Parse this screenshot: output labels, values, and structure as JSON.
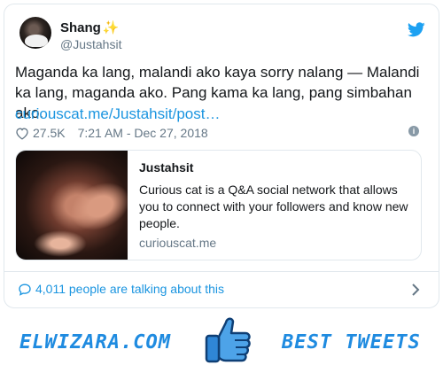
{
  "tweet": {
    "user_name": "Shang",
    "name_emoji": "✨",
    "user_handle": "@Justahsit",
    "text": "Maganda ka lang, malandi ako kaya sorry nalang — Malandi ka lang, maganda ako. Pang kama ka lang, pang simbahan ako.",
    "link": "curiouscat.me/Justahsit/post…",
    "likes": "27.5K",
    "timestamp": "7:21 AM - Dec 27, 2018",
    "info_glyph": "i"
  },
  "link_card": {
    "title": "Justahsit",
    "description": "Curious cat is a Q&A social network that allows you to connect with your followers and know new people.",
    "domain": "curiouscat.me"
  },
  "conversation": {
    "label": "4,011 people are talking about this"
  },
  "footer": {
    "left_text": "ELWIZARA.COM",
    "right_text": "BEST TWEETS"
  },
  "icons": {
    "bird": "twitter-bird-icon",
    "heart": "heart-icon",
    "info": "info-icon",
    "bubble": "speech-bubble-icon",
    "chevron": "chevron-right-icon",
    "thumbs": "thumbs-up-icon"
  },
  "colors": {
    "brand_blue": "#1da1f2",
    "link_blue": "#1b95e0",
    "muted": "#657786",
    "text": "#14171a",
    "border": "#e1e8ed"
  }
}
